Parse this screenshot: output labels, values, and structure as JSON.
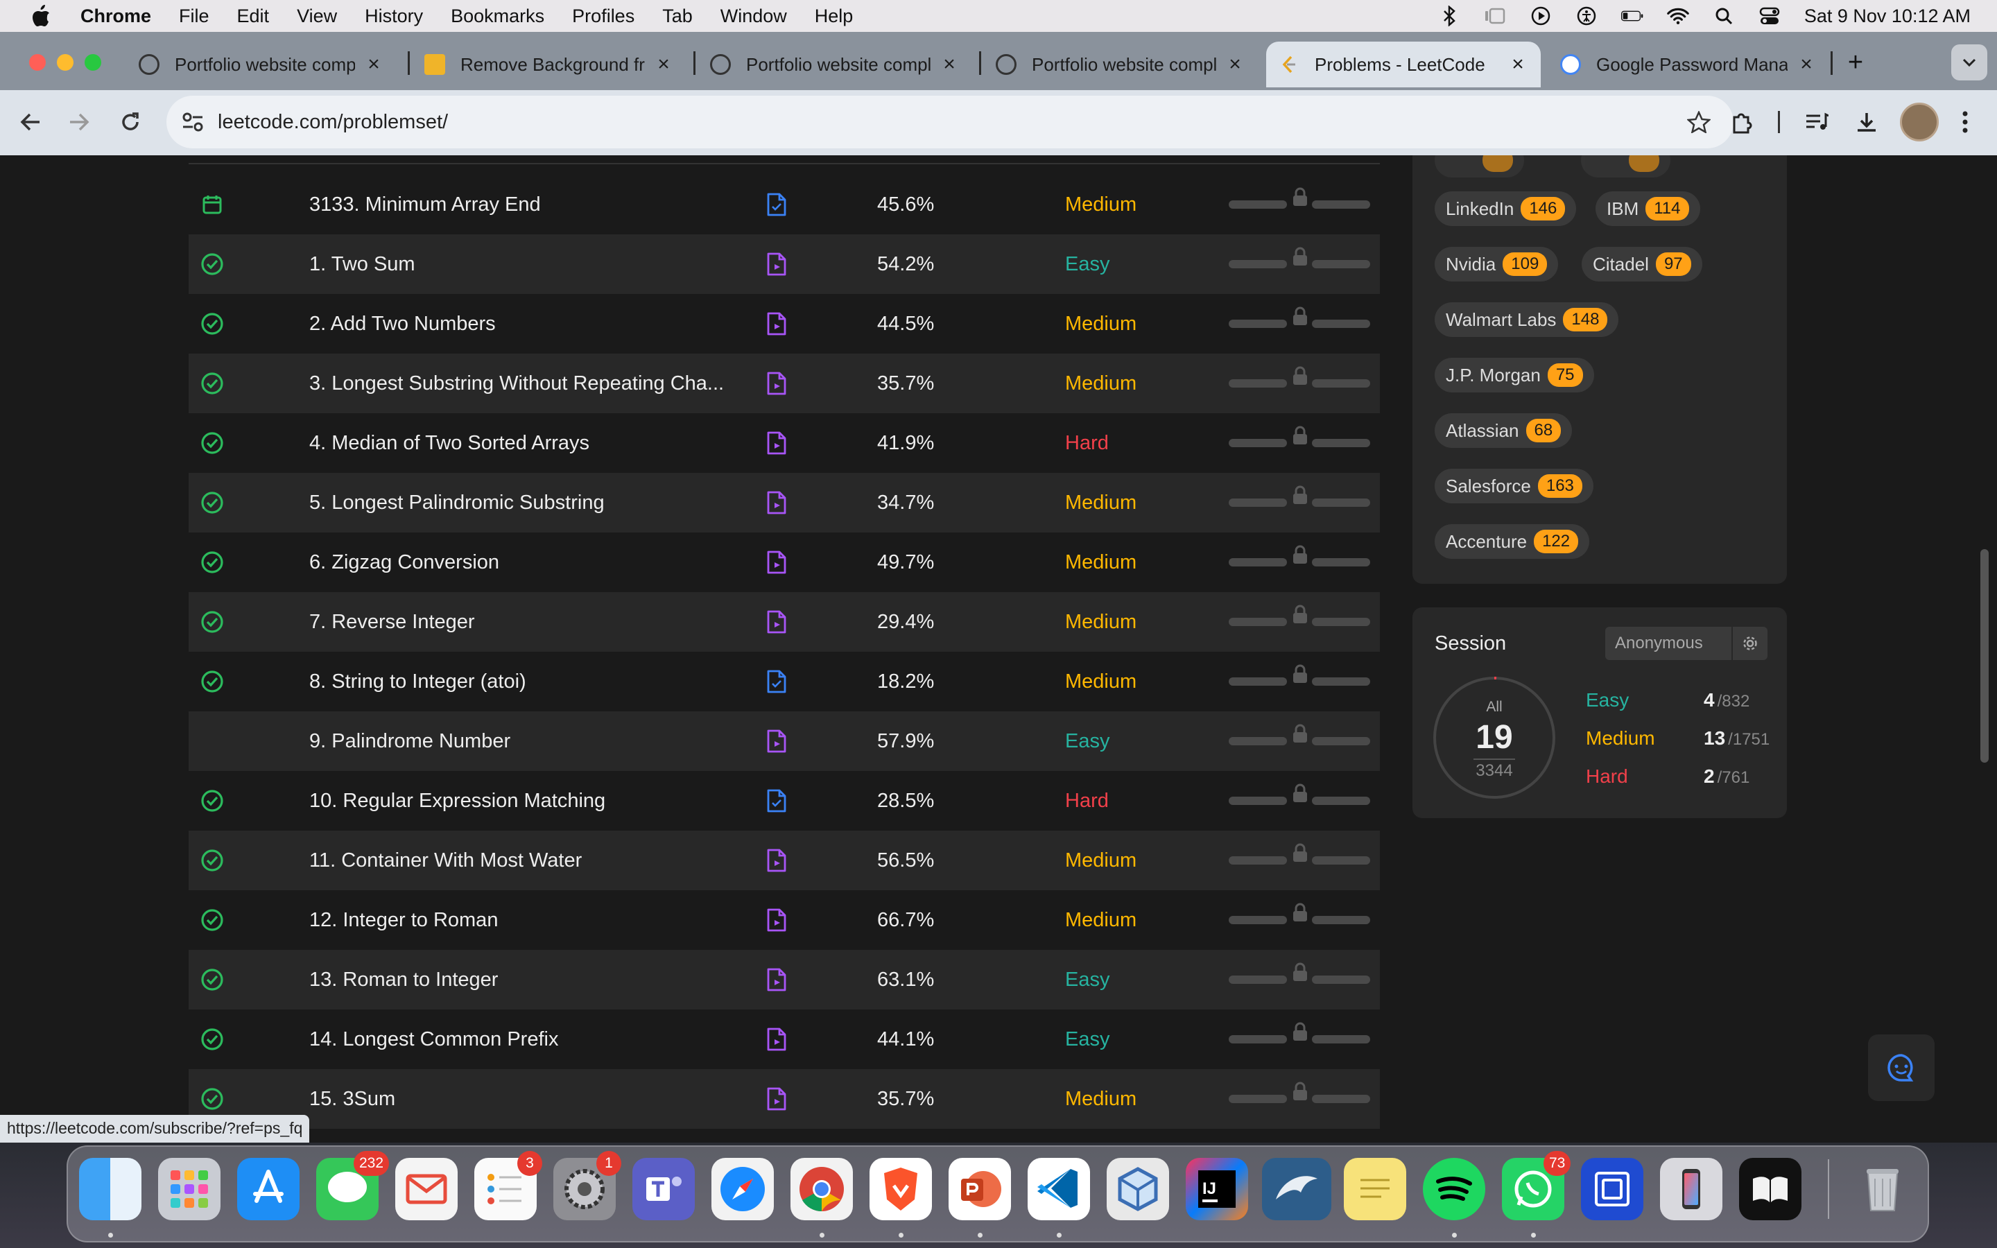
{
  "menubar": {
    "app": "Chrome",
    "items": [
      "File",
      "Edit",
      "View",
      "History",
      "Bookmarks",
      "Profiles",
      "Tab",
      "Window",
      "Help"
    ],
    "datetime": "Sat 9 Nov  10:12 AM"
  },
  "tabs": [
    {
      "title": "Portfolio website compl",
      "active": false
    },
    {
      "title": "Remove Background fro",
      "active": false
    },
    {
      "title": "Portfolio website compl",
      "active": false
    },
    {
      "title": "Portfolio website compl",
      "active": false
    },
    {
      "title": "Problems - LeetCode",
      "active": true
    },
    {
      "title": "Google Password Mana",
      "active": false
    }
  ],
  "toolbar": {
    "url": "leetcode.com/problemset/",
    "new_tab": "+"
  },
  "problems": [
    {
      "title": "3133. Minimum Array End",
      "status": "calendar",
      "solution": "blue",
      "acceptance": "45.6%",
      "difficulty": "Medium"
    },
    {
      "title": "1. Two Sum",
      "status": "solved",
      "solution": "purple",
      "acceptance": "54.2%",
      "difficulty": "Easy"
    },
    {
      "title": "2. Add Two Numbers",
      "status": "solved",
      "solution": "purple",
      "acceptance": "44.5%",
      "difficulty": "Medium"
    },
    {
      "title": "3. Longest Substring Without Repeating Cha...",
      "status": "solved",
      "solution": "purple",
      "acceptance": "35.7%",
      "difficulty": "Medium"
    },
    {
      "title": "4. Median of Two Sorted Arrays",
      "status": "solved",
      "solution": "purple",
      "acceptance": "41.9%",
      "difficulty": "Hard"
    },
    {
      "title": "5. Longest Palindromic Substring",
      "status": "solved",
      "solution": "purple",
      "acceptance": "34.7%",
      "difficulty": "Medium"
    },
    {
      "title": "6. Zigzag Conversion",
      "status": "solved",
      "solution": "purple",
      "acceptance": "49.7%",
      "difficulty": "Medium"
    },
    {
      "title": "7. Reverse Integer",
      "status": "solved",
      "solution": "purple",
      "acceptance": "29.4%",
      "difficulty": "Medium"
    },
    {
      "title": "8. String to Integer (atoi)",
      "status": "solved",
      "solution": "blue",
      "acceptance": "18.2%",
      "difficulty": "Medium"
    },
    {
      "title": "9. Palindrome Number",
      "status": "none",
      "solution": "purple",
      "acceptance": "57.9%",
      "difficulty": "Easy"
    },
    {
      "title": "10. Regular Expression Matching",
      "status": "solved",
      "solution": "blue",
      "acceptance": "28.5%",
      "difficulty": "Hard"
    },
    {
      "title": "11. Container With Most Water",
      "status": "solved",
      "solution": "purple",
      "acceptance": "56.5%",
      "difficulty": "Medium"
    },
    {
      "title": "12. Integer to Roman",
      "status": "solved",
      "solution": "purple",
      "acceptance": "66.7%",
      "difficulty": "Medium"
    },
    {
      "title": "13. Roman to Integer",
      "status": "solved",
      "solution": "purple",
      "acceptance": "63.1%",
      "difficulty": "Easy"
    },
    {
      "title": "14. Longest Common Prefix",
      "status": "solved",
      "solution": "purple",
      "acceptance": "44.1%",
      "difficulty": "Easy"
    },
    {
      "title": "15. 3Sum",
      "status": "solved",
      "solution": "purple",
      "acceptance": "35.7%",
      "difficulty": "Medium"
    }
  ],
  "companies": [
    {
      "name": "LinkedIn",
      "count": "146"
    },
    {
      "name": "IBM",
      "count": "114"
    },
    {
      "name": "Nvidia",
      "count": "109"
    },
    {
      "name": "Citadel",
      "count": "97"
    },
    {
      "name": "Walmart Labs",
      "count": "148"
    },
    {
      "name": "J.P. Morgan",
      "count": "75"
    },
    {
      "name": "Atlassian",
      "count": "68"
    },
    {
      "name": "Salesforce",
      "count": "163"
    },
    {
      "name": "Accenture",
      "count": "122"
    }
  ],
  "session": {
    "title": "Session",
    "name": "Anonymous",
    "all_label": "All",
    "solved": "19",
    "total": "3344",
    "easy": {
      "label": "Easy",
      "solved": "4",
      "total": "/832"
    },
    "medium": {
      "label": "Medium",
      "solved": "13",
      "total": "/1751"
    },
    "hard": {
      "label": "Hard",
      "solved": "2",
      "total": "/761"
    }
  },
  "status_url": "https://leetcode.com/subscribe/?ref=ps_fq",
  "dock": {
    "badges": {
      "messages": "232",
      "reminders": "3",
      "settings": "1",
      "whatsapp": "73"
    }
  },
  "colors": {
    "easy": "#26b3a0",
    "medium": "#ffb800",
    "hard": "#f2404a",
    "accent": "#ffa116"
  }
}
